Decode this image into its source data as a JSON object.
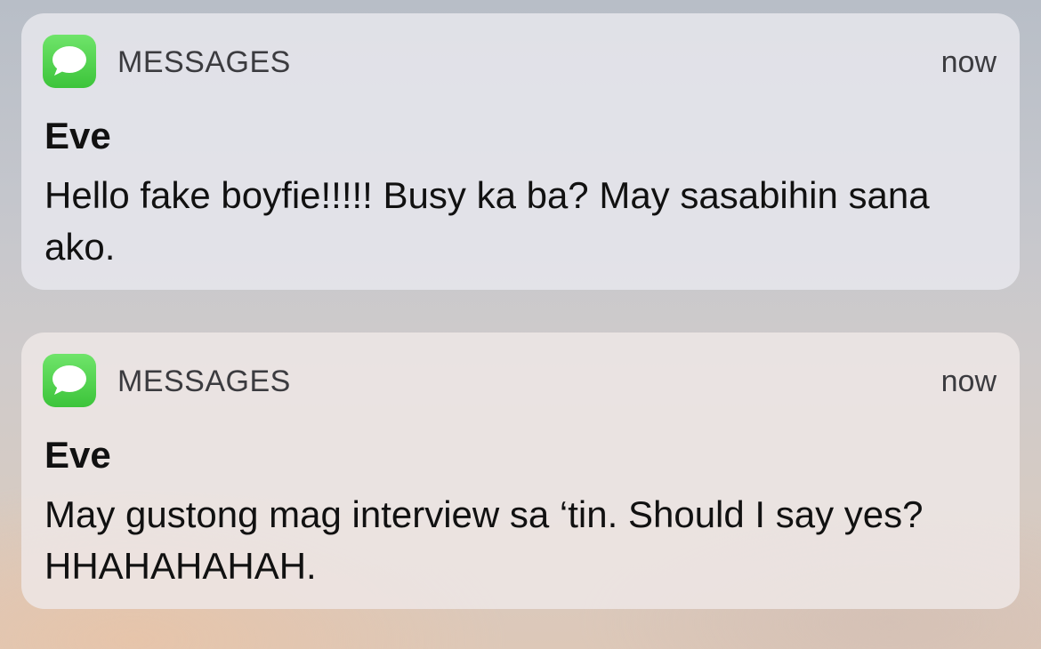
{
  "notifications": [
    {
      "app_name": "MESSAGES",
      "app_icon": "messages-icon",
      "time": "now",
      "sender": "Eve",
      "message": "Hello fake boyfie!!!!! Busy ka ba? May sasabihin sana ako."
    },
    {
      "app_name": "MESSAGES",
      "app_icon": "messages-icon",
      "time": "now",
      "sender": "Eve",
      "message": "May gustong mag interview sa ‘tin. Should I say yes? HHAHAHAHAH."
    }
  ],
  "colors": {
    "messages_icon_green": "#4cd14a",
    "card_background": "#e6e7ec",
    "text_primary": "#111111",
    "text_secondary": "#3b3b3f"
  }
}
